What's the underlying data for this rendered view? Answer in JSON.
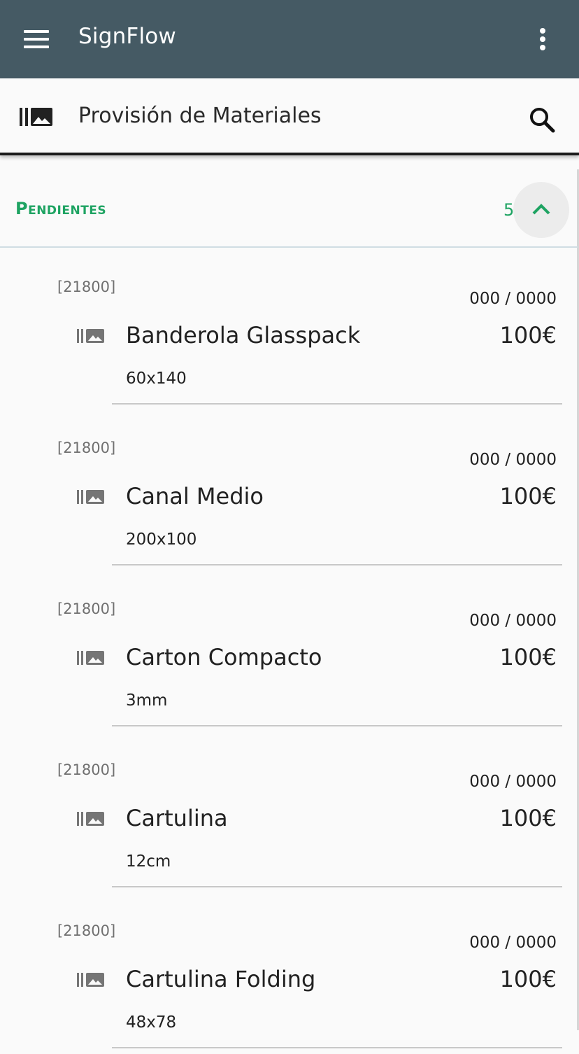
{
  "appbar": {
    "title": "SignFlow",
    "menu_icon": "hamburger-menu-icon",
    "more_icon": "more-vertical-icon",
    "background": "#455a64"
  },
  "toolbar": {
    "section_icon": "materials-library-icon",
    "title": "Provisión de Materiales",
    "search_icon": "search-icon"
  },
  "group": {
    "title": "Pendientes",
    "count": "5",
    "collapse_icon": "chevron-up-icon",
    "accent": "#1ea362"
  },
  "items": [
    {
      "ref": "[21800]",
      "qty": "000 / 0000",
      "name": "Banderola Glasspack",
      "price": "100€",
      "dims": "60x140"
    },
    {
      "ref": "[21800]",
      "qty": "000 / 0000",
      "name": "Canal Medio",
      "price": "100€",
      "dims": "200x100"
    },
    {
      "ref": "[21800]",
      "qty": "000 / 0000",
      "name": "Carton Compacto",
      "price": "100€",
      "dims": "3mm"
    },
    {
      "ref": "[21800]",
      "qty": "000 / 0000",
      "name": "Cartulina",
      "price": "100€",
      "dims": "12cm"
    },
    {
      "ref": "[21800]",
      "qty": "000 / 0000",
      "name": "Cartulina Folding",
      "price": "100€",
      "dims": "48x78"
    }
  ]
}
